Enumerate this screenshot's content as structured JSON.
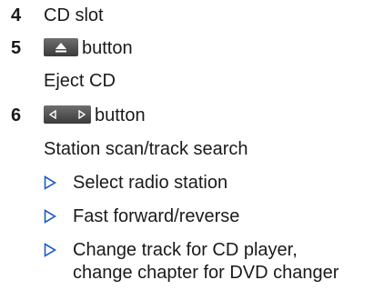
{
  "items": [
    {
      "number": "4",
      "label": "CD slot"
    },
    {
      "number": "5",
      "label": "button",
      "icon": "eject-icon",
      "description": "Eject CD"
    },
    {
      "number": "6",
      "label": "button",
      "icon": "seek-left-right-icon",
      "description": "Station scan/track search",
      "bullets": [
        "Select radio station",
        "Fast forward/reverse",
        "Change track for CD player,",
        "change chapter for DVD changer"
      ]
    }
  ],
  "colors": {
    "text": "#1a1a1a",
    "bullet": "#1a5ccc",
    "key_dark": "#3a3a3a",
    "key_light": "#6f6f6f"
  }
}
